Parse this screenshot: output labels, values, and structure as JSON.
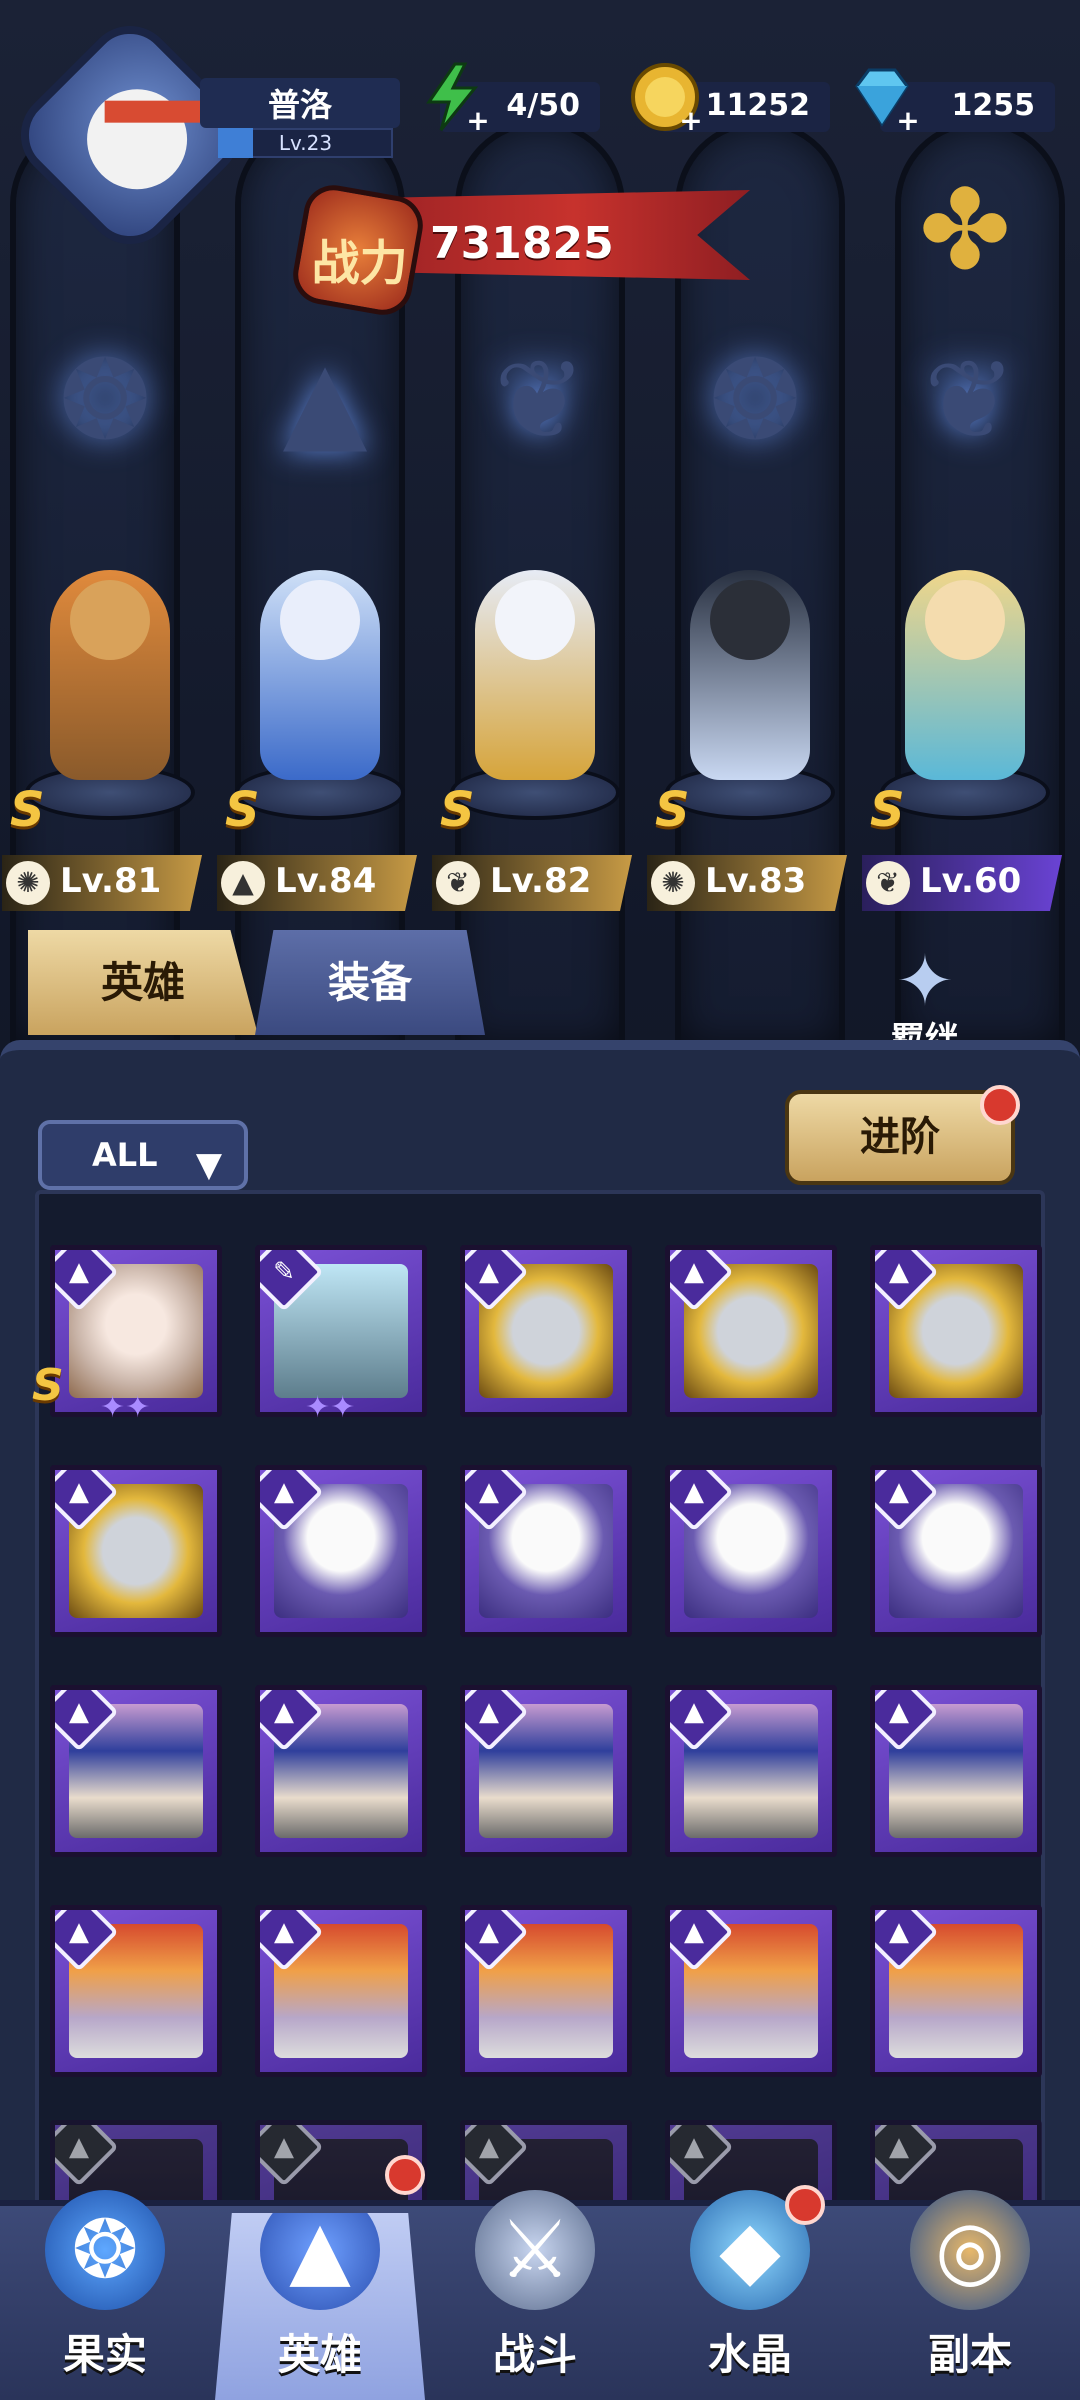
{
  "player": {
    "name": "普洛",
    "level": "Lv.23",
    "exp_fraction": 0.2
  },
  "resources": {
    "energy": "4/50",
    "gold": "11252",
    "diamonds": "1255"
  },
  "power": {
    "badge": "战力",
    "value": "731825"
  },
  "lineup": [
    {
      "level": "Lv.81",
      "rank": "S",
      "class_icon": "beast-icon"
    },
    {
      "level": "Lv.84",
      "rank": "S",
      "class_icon": "mage-hat-icon"
    },
    {
      "level": "Lv.82",
      "rank": "S",
      "class_icon": "wing-icon"
    },
    {
      "level": "Lv.83",
      "rank": "S",
      "class_icon": "beast-icon"
    },
    {
      "level": "Lv.60",
      "rank": "S",
      "class_icon": "wing-icon"
    }
  ],
  "tabs": {
    "heroes": "英雄",
    "equipment": "装备"
  },
  "bond_label": "羁绊",
  "filter_label": "ALL",
  "advance_label": "进阶",
  "nav": [
    {
      "label": "果实",
      "icon": "fruit-icon"
    },
    {
      "label": "英雄",
      "icon": "hero-icon"
    },
    {
      "label": "战斗",
      "icon": "battle-icon"
    },
    {
      "label": "水晶",
      "icon": "crystal-icon"
    },
    {
      "label": "副本",
      "icon": "dungeon-icon"
    }
  ],
  "colors": {
    "accent_gold": "#c9a35f",
    "card_purple": "#4a2b9c",
    "power_red": "#c7322d"
  }
}
